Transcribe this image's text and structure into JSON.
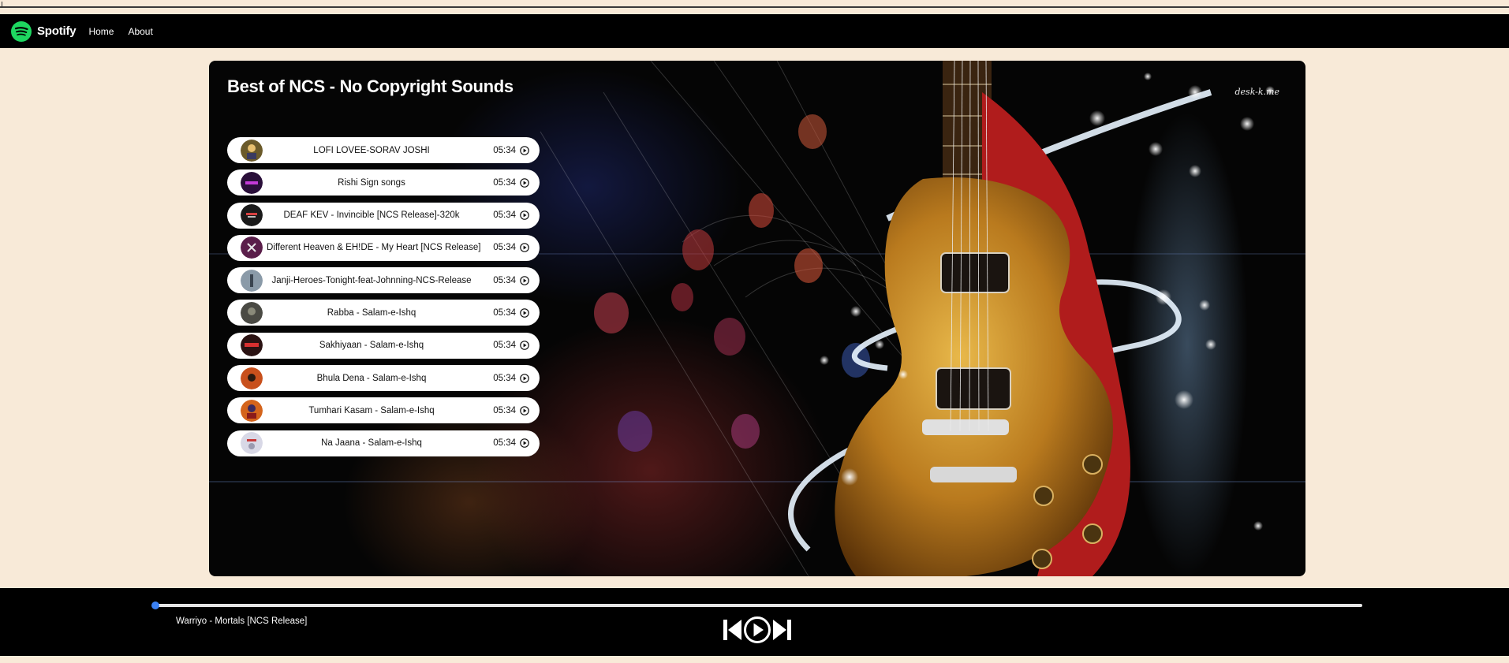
{
  "nav": {
    "brand": "Spotify",
    "links": [
      "Home",
      "About"
    ]
  },
  "playlist": {
    "title": "Best of NCS - No Copyright Sounds",
    "watermark": "desk-k.me",
    "songs": [
      {
        "name": "LOFI LOVEE-SORAV JOSHI",
        "duration": "05:34",
        "cover_color": "#6b5a2a"
      },
      {
        "name": "Rishi Sign songs",
        "duration": "05:34",
        "cover_color": "#2a0f3a"
      },
      {
        "name": "DEAF KEV - Invincible [NCS Release]-320k",
        "duration": "05:34",
        "cover_color": "#1a1a1a"
      },
      {
        "name": "Different Heaven & EH!DE - My Heart [NCS Release]",
        "duration": "05:34",
        "cover_color": "#5a1e4a"
      },
      {
        "name": "Janji-Heroes-Tonight-feat-Johnning-NCS-Release",
        "duration": "05:34",
        "cover_color": "#8a9aa8"
      },
      {
        "name": "Rabba - Salam-e-Ishq",
        "duration": "05:34",
        "cover_color": "#4a4a44"
      },
      {
        "name": "Sakhiyaan - Salam-e-Ishq",
        "duration": "05:34",
        "cover_color": "#2a1212"
      },
      {
        "name": "Bhula Dena - Salam-e-Ishq",
        "duration": "05:34",
        "cover_color": "#c8501c"
      },
      {
        "name": "Tumhari Kasam - Salam-e-Ishq",
        "duration": "05:34",
        "cover_color": "#d4641c"
      },
      {
        "name": "Na Jaana - Salam-e-Ishq",
        "duration": "05:34",
        "cover_color": "#d8d8e6"
      }
    ]
  },
  "player": {
    "current_song": "Warriyo - Mortals [NCS Release]",
    "progress_percent": 0,
    "icons": {
      "previous": "skip-previous-icon",
      "play": "play-circle-icon",
      "next": "skip-next-icon"
    }
  },
  "colors": {
    "brand_green": "#1ed760",
    "page_bg": "#f8ead8",
    "bar_bg": "#000000",
    "progress_accent": "#3b82f6"
  }
}
